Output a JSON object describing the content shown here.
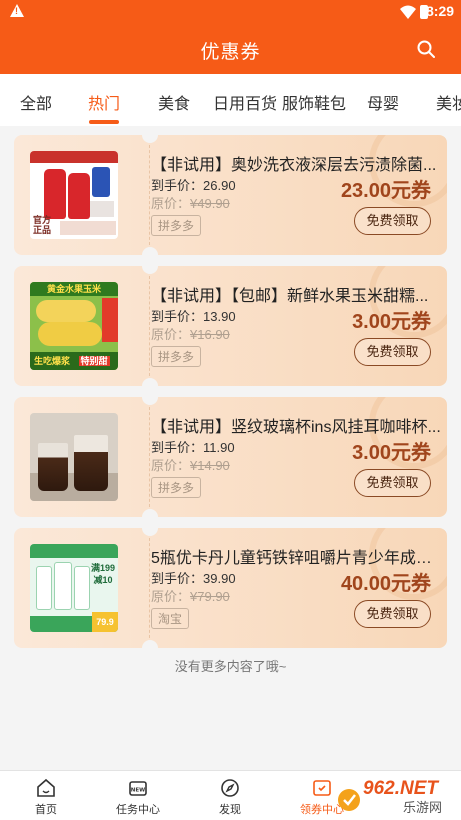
{
  "status": {
    "time": "8:29"
  },
  "header": {
    "title": "优惠券"
  },
  "tabs": [
    {
      "label": "全部"
    },
    {
      "label": "热门"
    },
    {
      "label": "美食"
    },
    {
      "label": "日用百货"
    },
    {
      "label": "服饰鞋包"
    },
    {
      "label": "母婴"
    },
    {
      "label": "美妆"
    }
  ],
  "labels": {
    "final_prefix": "到手价：",
    "orig_prefix": "原价：",
    "claim": "免费领取"
  },
  "items": [
    {
      "title": "【非试用】奥妙洗衣液深层去污渍除菌...",
      "final_price": "26.90",
      "original_price": "¥49.90",
      "coupon": "23.00元券",
      "platform": "拼多多",
      "thumb_text": [
        "官方",
        "正品"
      ]
    },
    {
      "title": "【非试用】【包邮】新鲜水果玉米甜糯...",
      "final_price": "13.90",
      "original_price": "¥16.90",
      "coupon": "3.00元券",
      "platform": "拼多多",
      "thumb_text": [
        "黄金水果玉米",
        "生吃爆浆",
        "特别甜"
      ]
    },
    {
      "title": "【非试用】竖纹玻璃杯ins风挂耳咖啡杯...",
      "final_price": "11.90",
      "original_price": "¥14.90",
      "coupon": "3.00元券",
      "platform": "拼多多",
      "thumb_text": []
    },
    {
      "title": "5瓶优卡丹儿童钙铁锌咀嚼片青少年成长...",
      "final_price": "39.90",
      "original_price": "¥79.90",
      "coupon": "40.00元券",
      "platform": "淘宝",
      "thumb_text": [
        "满199",
        "减10",
        "79.9"
      ]
    }
  ],
  "footer_note": "没有更多内容了哦~",
  "bottom_nav": [
    {
      "label": "首页"
    },
    {
      "label": "任务中心"
    },
    {
      "label": "发现"
    },
    {
      "label": "领券中心"
    }
  ],
  "watermark": {
    "text": "962.NET",
    "sub": "乐游网"
  },
  "colors": {
    "brand": "#f65b17",
    "coupon_text": "#a0451c"
  }
}
